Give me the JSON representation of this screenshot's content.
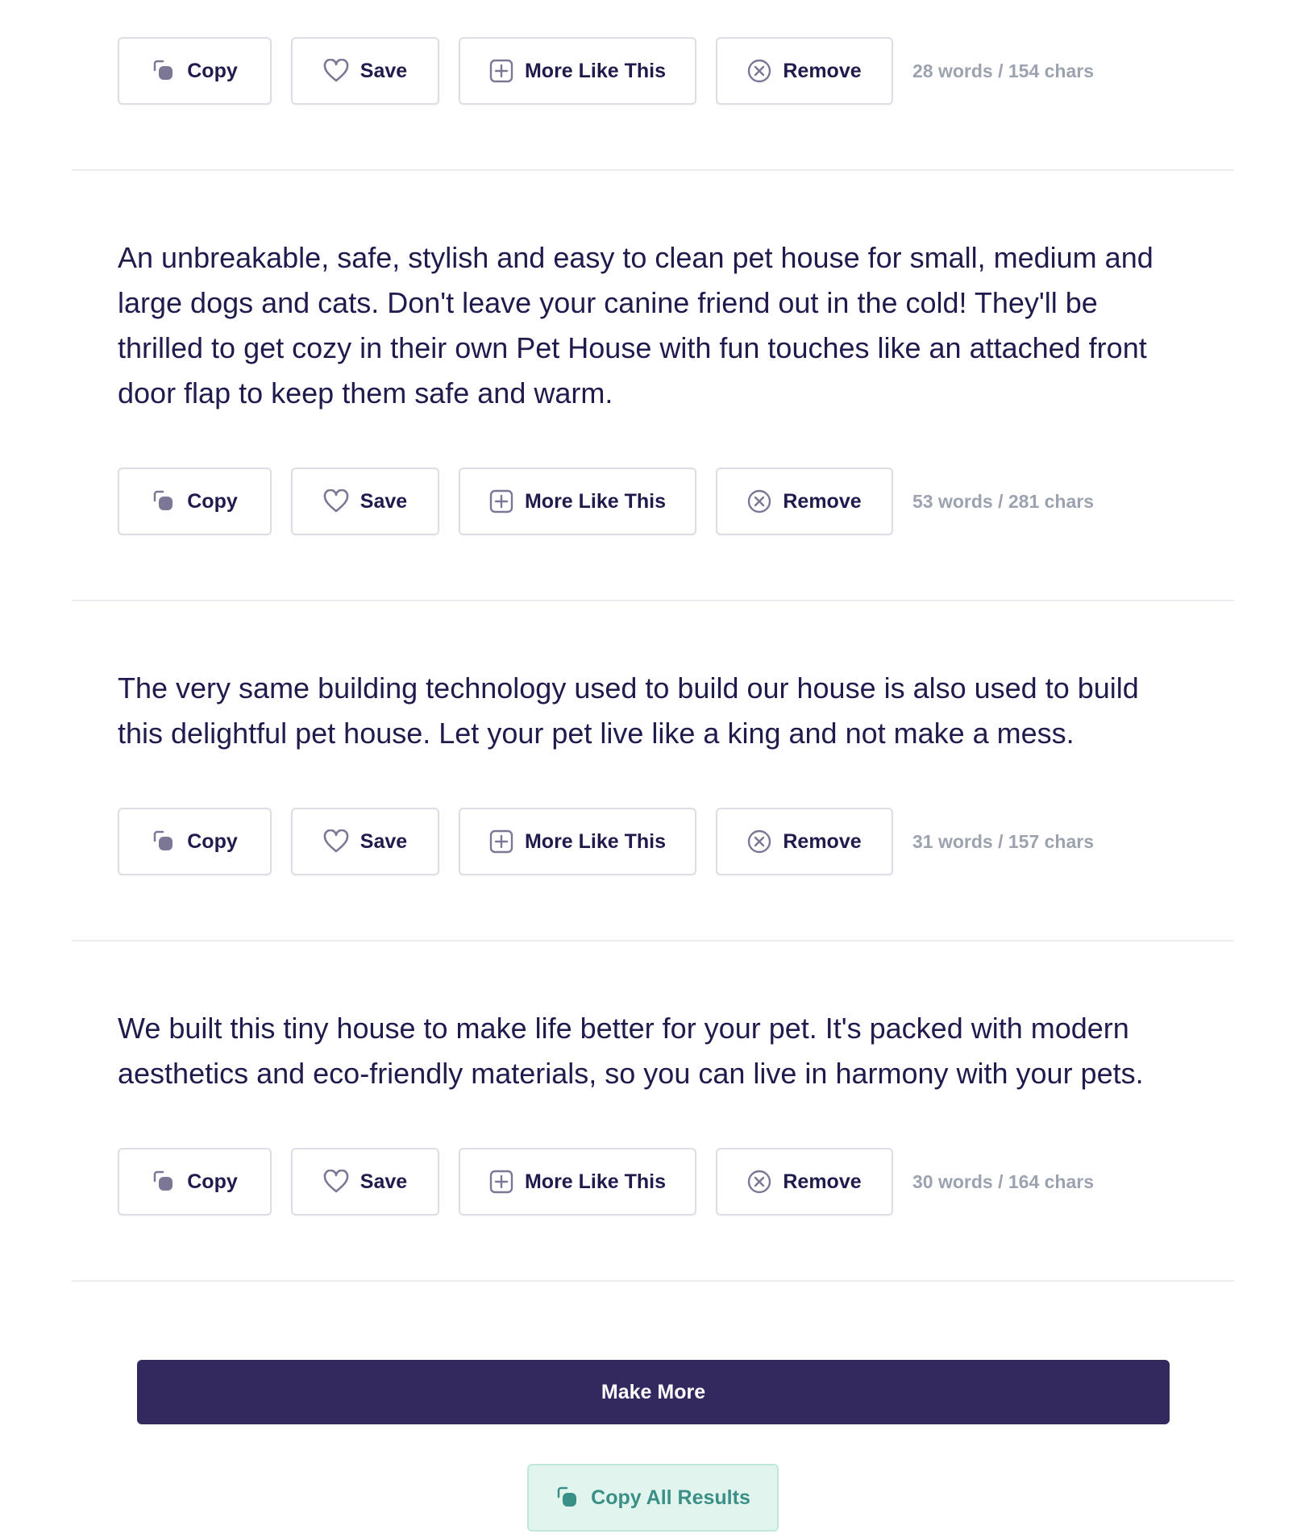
{
  "actions": {
    "copy_label": "Copy",
    "save_label": "Save",
    "more_label": "More Like This",
    "remove_label": "Remove"
  },
  "results": [
    {
      "text": "",
      "stats": "28 words / 154 chars"
    },
    {
      "text": "An unbreakable, safe, stylish and easy to clean pet house for small, medium and large dogs and cats. Don't leave your canine friend out in the cold! They'll be thrilled to get cozy in their own Pet House with fun touches like an attached front door flap to keep them safe and warm.",
      "stats": "53 words / 281 chars"
    },
    {
      "text": "The very same building technology used to build our house is also used to build this delightful pet house. Let your pet live like a king and not make a mess.",
      "stats": "31 words / 157 chars"
    },
    {
      "text": "We built this tiny house to make life better for your pet. It's packed with modern aesthetics and eco-friendly materials, so you can live in harmony with your pets.",
      "stats": "30 words / 164 chars"
    }
  ],
  "footer": {
    "make_more_label": "Make More",
    "copy_all_label": "Copy All Results"
  },
  "colors": {
    "primary": "#34295f",
    "text": "#1f1b4d",
    "muted": "#9ca3af",
    "copy_all_bg": "#e1f5ee",
    "copy_all_text": "#3a8f86",
    "icon": "#7c7794"
  }
}
